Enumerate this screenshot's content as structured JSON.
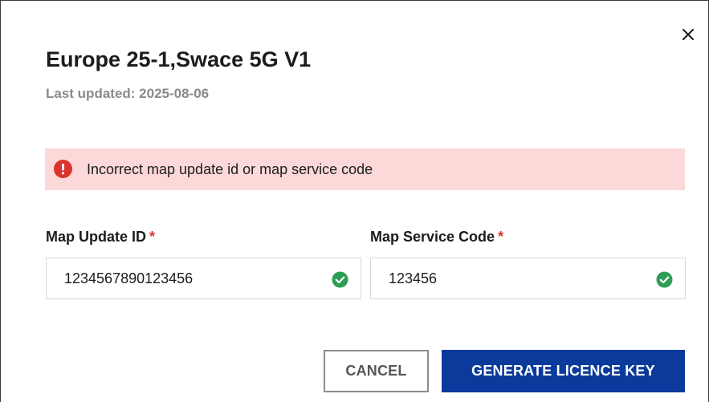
{
  "dialog": {
    "title": "Europe 25-1,Swace 5G V1",
    "last_updated": "Last updated: 2025-08-06",
    "close_icon": "close-icon"
  },
  "alert": {
    "icon": "error-icon",
    "message": "Incorrect map update id or map service code",
    "background": "#fcd9d8",
    "icon_color": "#d9342b"
  },
  "fields": [
    {
      "label": "Map Update ID",
      "required_marker": "*",
      "value": "1234567890123456",
      "status_icon": "check-circle-icon"
    },
    {
      "label": "Map Service Code",
      "required_marker": "*",
      "value": "123456",
      "status_icon": "check-circle-icon"
    }
  ],
  "actions": {
    "cancel_label": "CANCEL",
    "primary_label": "GENERATE LICENCE KEY",
    "primary_color": "#0a3a9c",
    "success_color": "#2e9e57"
  }
}
